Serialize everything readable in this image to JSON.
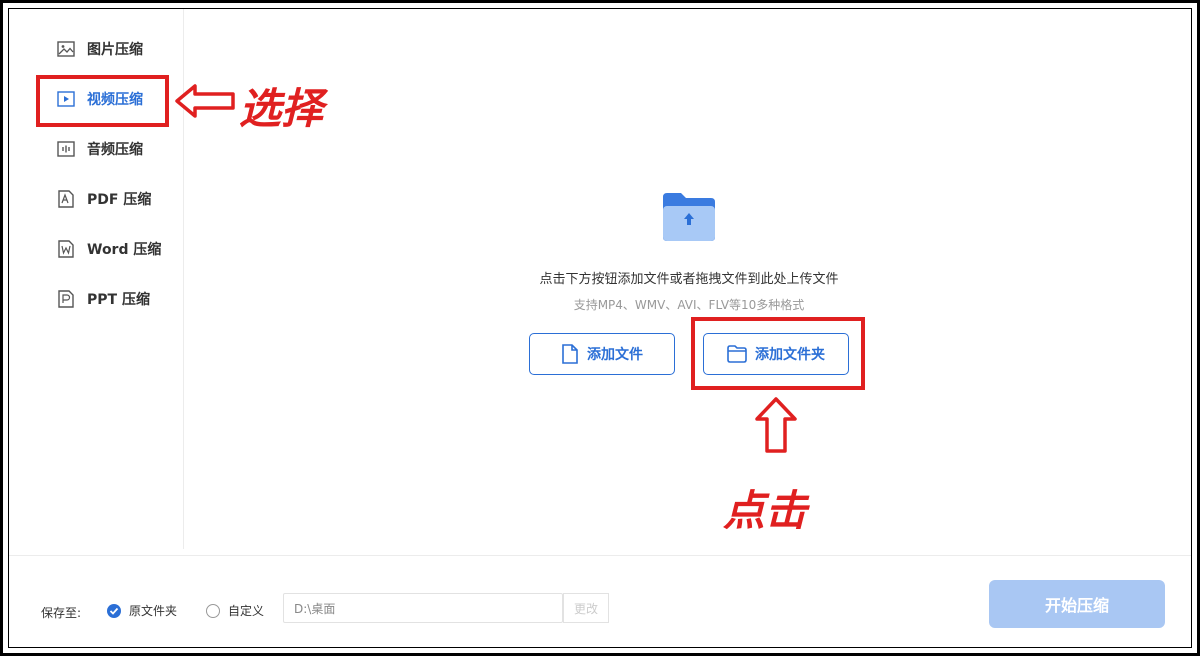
{
  "sidebar": {
    "items": [
      {
        "label": "图片压缩",
        "icon": "image-icon",
        "active": false
      },
      {
        "label": "视频压缩",
        "icon": "video-play-icon",
        "active": true
      },
      {
        "label": "音频压缩",
        "icon": "audio-icon",
        "active": false
      },
      {
        "label": "PDF 压缩",
        "icon": "pdf-file-icon",
        "active": false
      },
      {
        "label": "Word 压缩",
        "icon": "word-file-icon",
        "active": false
      },
      {
        "label": "PPT 压缩",
        "icon": "ppt-file-icon",
        "active": false
      }
    ]
  },
  "upload": {
    "icon": "folder-upload-icon",
    "hint": "点击下方按钮添加文件或者拖拽文件到此处上传文件",
    "formats": "支持MP4、WMV、AVI、FLV等10多种格式",
    "add_file_label": "添加文件",
    "add_folder_label": "添加文件夹"
  },
  "footer": {
    "save_to_label": "保存至:",
    "option_original": "原文件夹",
    "option_custom": "自定义",
    "selected_option": "原文件夹",
    "path_value": "D:\\桌面",
    "change_label": "更改",
    "start_label": "开始压缩"
  },
  "annotations": {
    "select_text": "选择",
    "click_text": "点击"
  },
  "colors": {
    "accent": "#2b6fd6",
    "annotation_red": "#e02020",
    "start_button_disabled": "#a9c7f3"
  }
}
